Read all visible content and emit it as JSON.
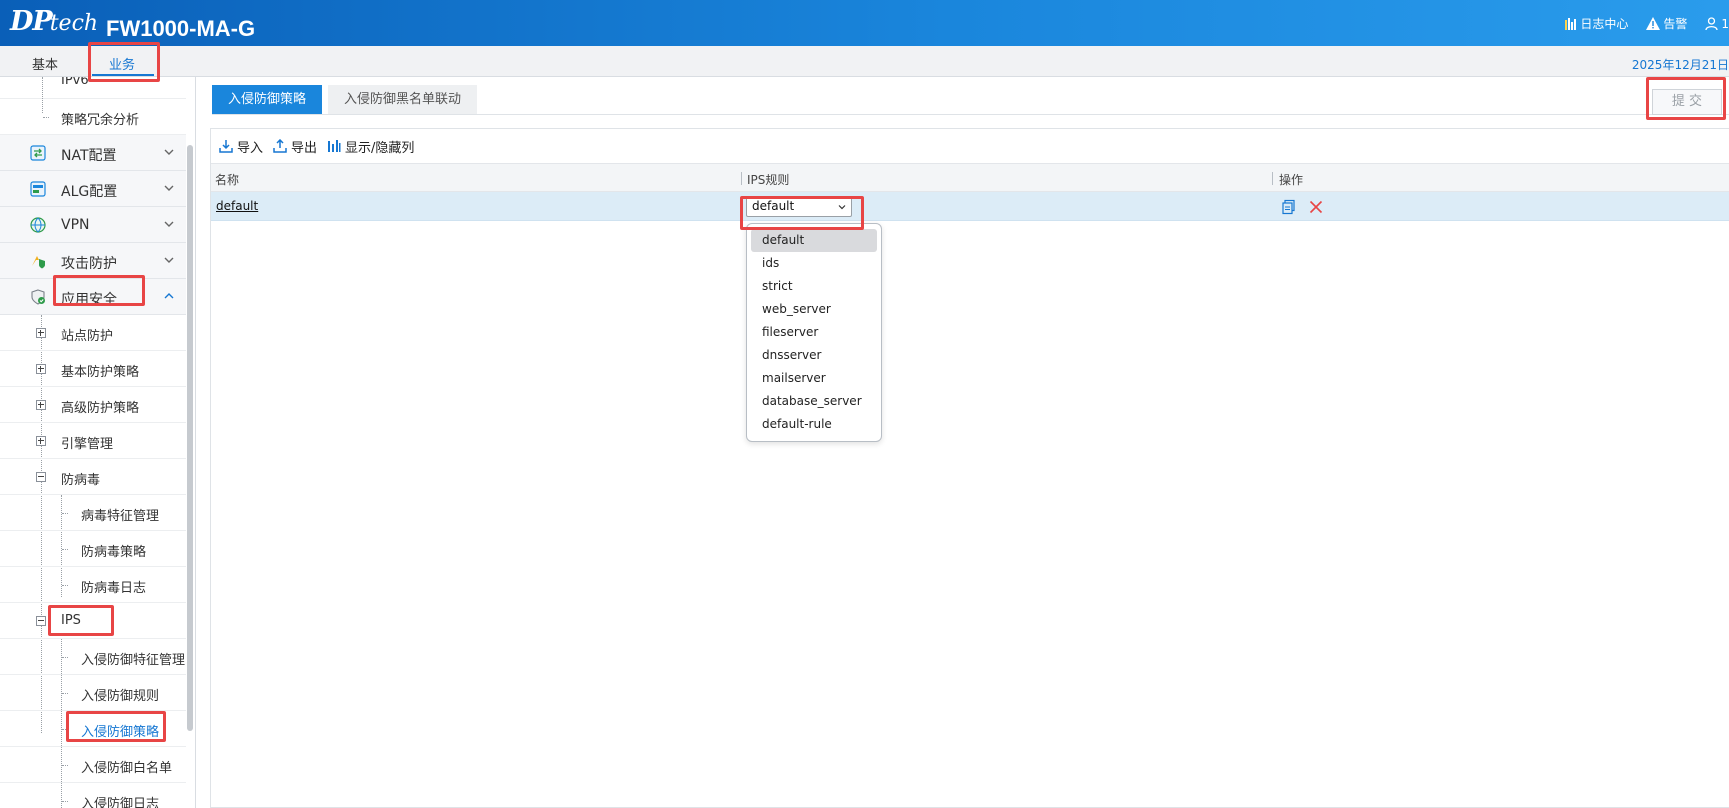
{
  "header": {
    "logo_main": "DP",
    "logo_sub": "tech",
    "model": "FW1000-MA-G",
    "log_center": "日志中心",
    "alarm": "告警",
    "user": "1"
  },
  "top_tabs": [
    {
      "label": "基本",
      "active": false
    },
    {
      "label": "业务",
      "active": true
    }
  ],
  "date": "2025年12月21日",
  "sidebar": {
    "cut_item": "IPv6",
    "policy_redundancy": "策略冗余分析",
    "groups": [
      {
        "label": "NAT配置",
        "icon": "nat-icon",
        "expanded": false
      },
      {
        "label": "ALG配置",
        "icon": "alg-icon",
        "expanded": false
      },
      {
        "label": "VPN",
        "icon": "vpn-icon",
        "expanded": false
      },
      {
        "label": "攻击防护",
        "icon": "attack-protection-icon",
        "expanded": false
      },
      {
        "label": "应用安全",
        "icon": "app-security-icon",
        "expanded": true
      }
    ],
    "app_security": [
      {
        "label": "站点防护",
        "state": "plus"
      },
      {
        "label": "基本防护策略",
        "state": "plus"
      },
      {
        "label": "高级防护策略",
        "state": "plus"
      },
      {
        "label": "引擎管理",
        "state": "plus"
      },
      {
        "label": "防病毒",
        "state": "minus"
      }
    ],
    "antivirus_children": [
      "病毒特征管理",
      "防病毒策略",
      "防病毒日志"
    ],
    "ips": "IPS",
    "ips_children": [
      {
        "label": "入侵防御特征管理",
        "active": false
      },
      {
        "label": "入侵防御规则",
        "active": false
      },
      {
        "label": "入侵防御策略",
        "active": true
      },
      {
        "label": "入侵防御白名单",
        "active": false
      },
      {
        "label": "入侵防御日志",
        "active": false
      }
    ]
  },
  "main": {
    "subtabs": [
      {
        "label": "入侵防御策略",
        "active": true
      },
      {
        "label": "入侵防御黑名单联动",
        "active": false
      }
    ],
    "submit_label": "提 交",
    "toolbar": {
      "import_label": "导入",
      "export_label": "导出",
      "toggle_columns_label": "显示/隐藏列"
    },
    "table": {
      "columns": [
        "名称",
        "IPS规则",
        "操作"
      ],
      "rows": [
        {
          "name": "default",
          "ips_rule": "default"
        }
      ]
    },
    "dropdown": {
      "selected": "default",
      "options": [
        "default",
        "ids",
        "strict",
        "web_server",
        "fileserver",
        "dnsserver",
        "mailserver",
        "database_server",
        "default-rule"
      ]
    }
  },
  "colors": {
    "accent": "#1677d2",
    "header_blue": "#1a86dc",
    "highlight_red": "#e84545",
    "row_selected": "#dcecf7"
  }
}
